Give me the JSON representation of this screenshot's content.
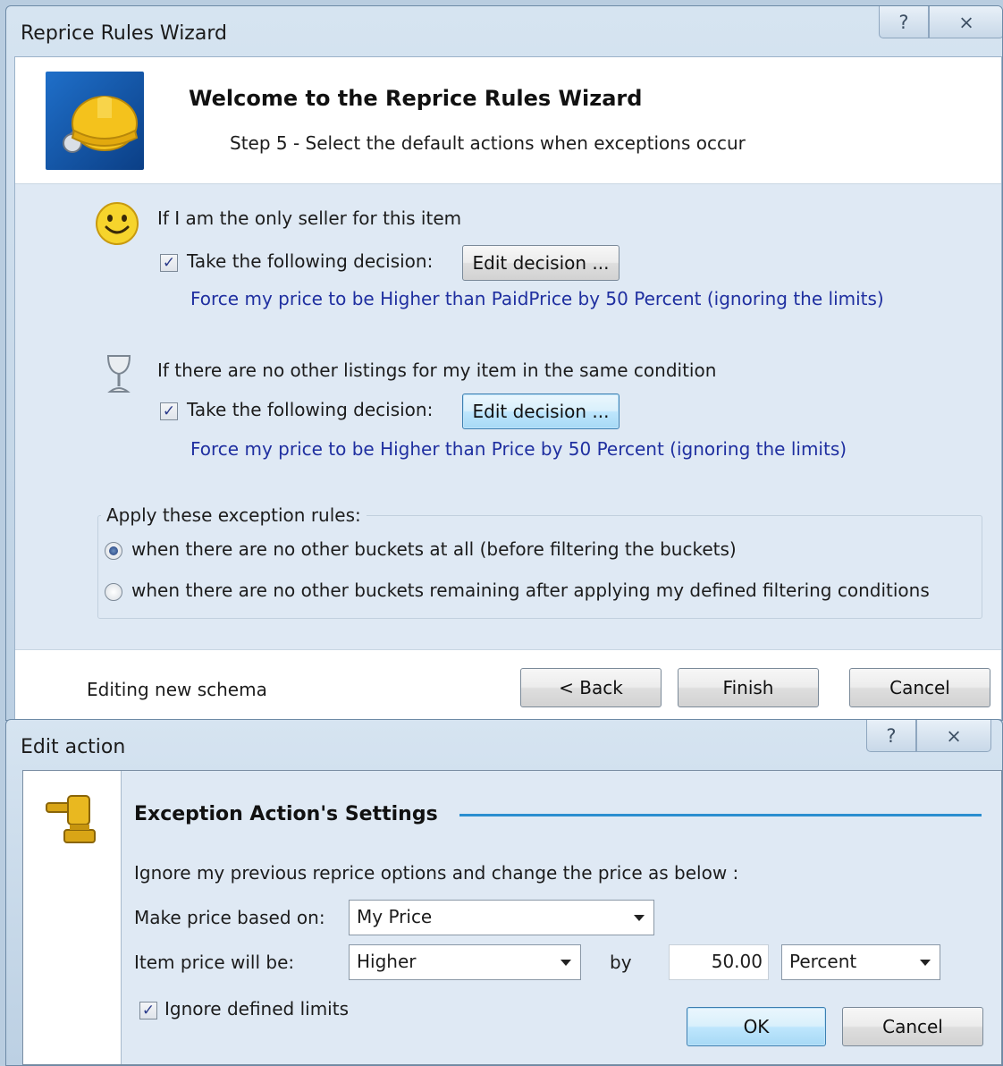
{
  "wizard": {
    "title": "Reprice Rules Wizard",
    "help_glyph": "?",
    "close_glyph": "⨯",
    "heading": "Welcome to the Reprice Rules Wizard",
    "step": "Step 5 - Select the default actions when exceptions occur",
    "rules": [
      {
        "condition": "If I am the only seller for this item",
        "checkbox_label": "Take the following decision:",
        "checked": true,
        "edit_button": "Edit decision ...",
        "description": "Force my price to be Higher than PaidPrice by 50 Percent (ignoring the limits)",
        "icon": "smiley-icon"
      },
      {
        "condition": "If there are no other listings for my item in the same condition",
        "checkbox_label": "Take the following decision:",
        "checked": true,
        "edit_button": "Edit decision ...",
        "description": "Force my price to be Higher than Price by 50 Percent (ignoring the limits)",
        "icon": "goblet-icon"
      }
    ],
    "group_label": "Apply these exception rules:",
    "options": [
      {
        "label": "when there are no other buckets at all (before filtering the buckets)",
        "selected": true
      },
      {
        "label": "when there are no other buckets remaining after applying my defined filtering conditions",
        "selected": false
      }
    ],
    "status": "Editing new schema",
    "buttons": {
      "back": "< Back",
      "finish": "Finish",
      "cancel": "Cancel"
    }
  },
  "edit_action": {
    "title": "Edit action",
    "help_glyph": "?",
    "close_glyph": "⨯",
    "heading": "Exception Action's Settings",
    "instruction": "Ignore my previous reprice options and change the price as below :",
    "based_on_label": "Make price based on:",
    "based_on_value": "My Price",
    "price_will_be_label": "Item price will be:",
    "direction_value": "Higher",
    "by_label": "by",
    "amount_value": "50.00",
    "unit_value": "Percent",
    "ignore_limits_label": "Ignore defined limits",
    "ignore_limits_checked": true,
    "buttons": {
      "ok": "OK",
      "cancel": "Cancel"
    },
    "icon": "gavel-icon"
  },
  "colors": {
    "description_text": "#1f2fa0",
    "accent_line": "#2a8ed0",
    "logo_blue": "#1f6fc9"
  }
}
